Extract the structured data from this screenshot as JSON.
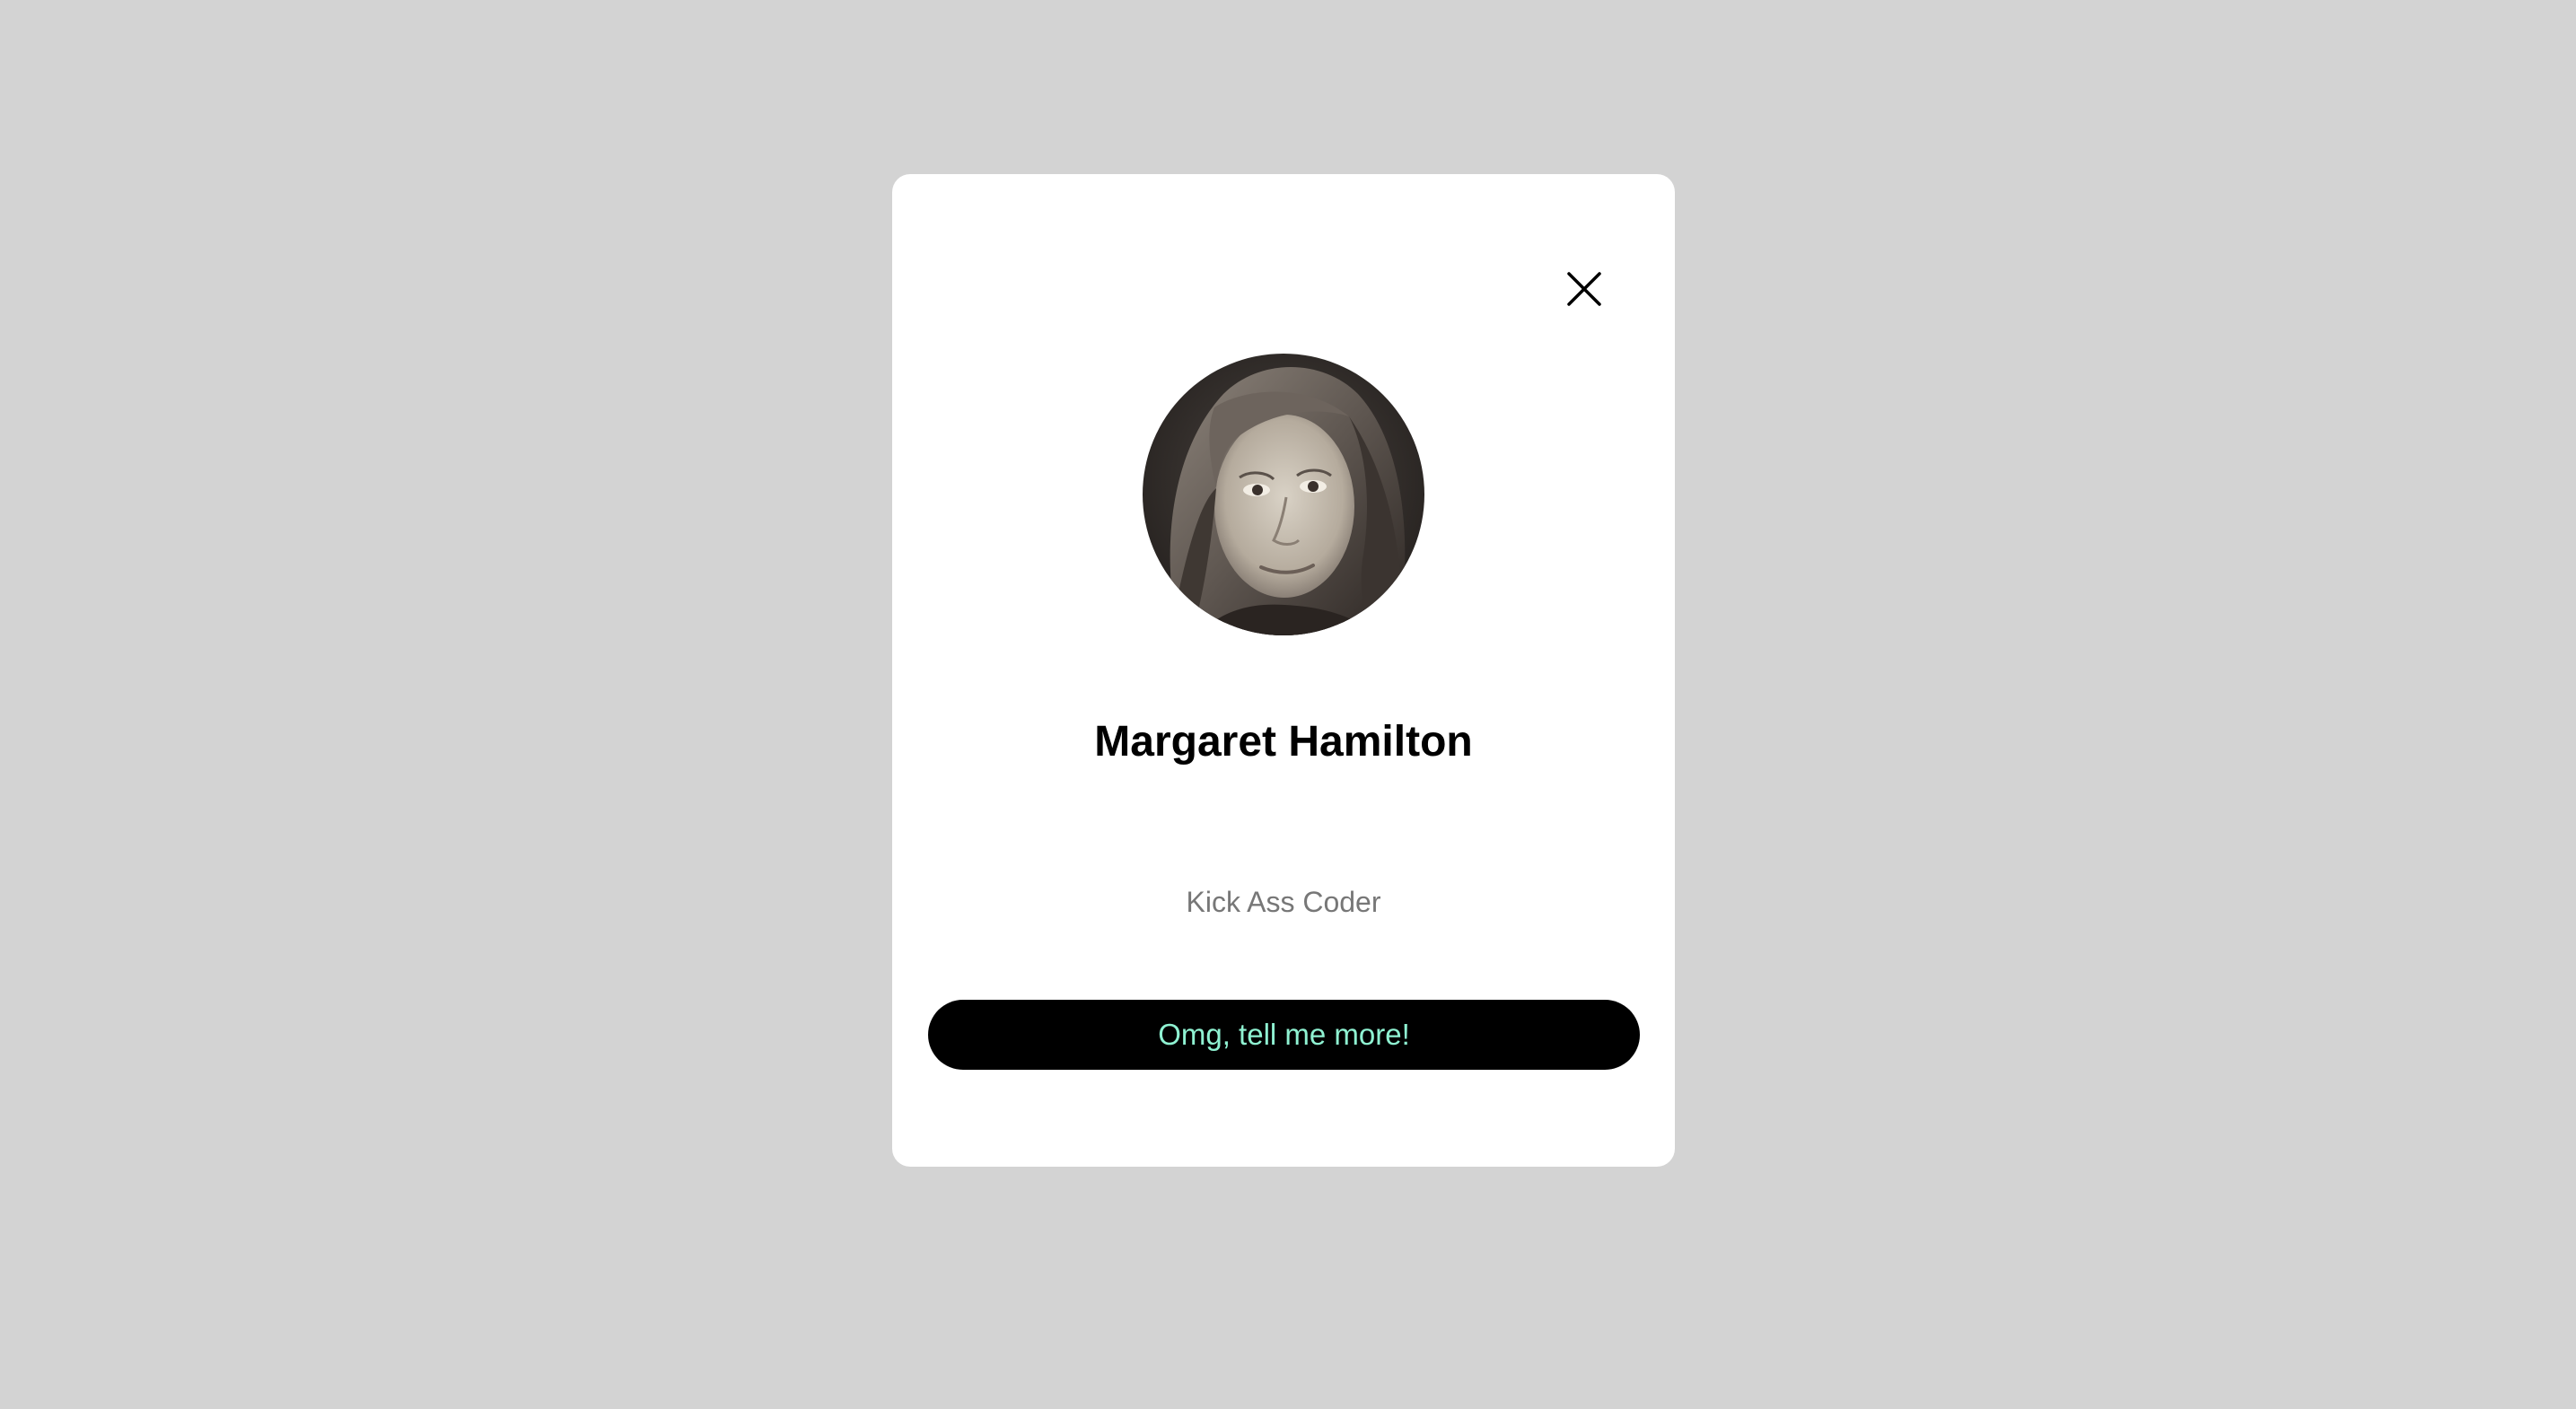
{
  "profile": {
    "name": "Margaret Hamilton",
    "role": "Kick Ass Coder",
    "cta_label": "Omg, tell me more!",
    "avatar_alt": "Margaret Hamilton portrait"
  },
  "icons": {
    "close": "close-icon"
  },
  "colors": {
    "background": "#d3d3d3",
    "card": "#ffffff",
    "name_text": "#000000",
    "role_text": "#777777",
    "button_bg": "#000000",
    "button_text": "#8ff2d2"
  }
}
